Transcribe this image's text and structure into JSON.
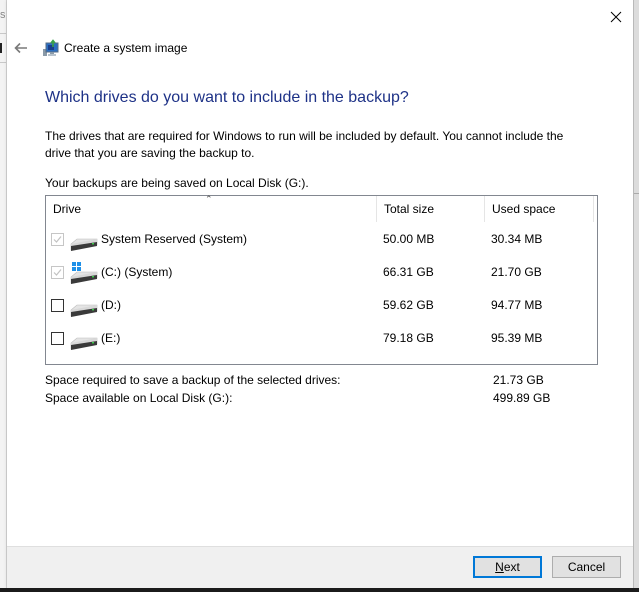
{
  "background_window": {
    "partial_char": "s"
  },
  "window": {
    "title": "Create a system image",
    "app_icon": "system-image-icon",
    "back_icon": "back-arrow-icon",
    "close_icon": "close-icon"
  },
  "page": {
    "heading": "Which drives do you want to include in the backup?",
    "description": "The drives that are required for Windows to run will be included by default. You cannot include the drive that you are saving the backup to.",
    "save_location_note": "Your backups are being saved on Local Disk (G:)."
  },
  "drive_list": {
    "columns": [
      {
        "label": "Drive",
        "sorted": "ascending"
      },
      {
        "label": "Total size"
      },
      {
        "label": "Used space"
      }
    ],
    "sort_icon": "sort-up-icon",
    "rows": [
      {
        "name": "System Reserved (System)",
        "total_size": "50.00 MB",
        "used_space": "30.34 MB",
        "checked": true,
        "disabled": true,
        "icon": "hard-drive-icon"
      },
      {
        "name": "(C:) (System)",
        "total_size": "66.31 GB",
        "used_space": "21.70 GB",
        "checked": true,
        "disabled": true,
        "icon": "windows-drive-icon"
      },
      {
        "name": "(D:)",
        "total_size": "59.62 GB",
        "used_space": "94.77 MB",
        "checked": false,
        "disabled": false,
        "icon": "hard-drive-icon"
      },
      {
        "name": "(E:)",
        "total_size": "79.18 GB",
        "used_space": "95.39 MB",
        "checked": false,
        "disabled": false,
        "icon": "hard-drive-icon"
      }
    ]
  },
  "summary": {
    "space_required_label": "Space required to save a backup of the selected drives:",
    "space_required_value": "21.73 GB",
    "space_available_label": "Space available on Local Disk (G:):",
    "space_available_value": "499.89 GB"
  },
  "buttons": {
    "next": {
      "label_mnemonic": "N",
      "label_rest": "ext"
    },
    "cancel": {
      "label": "Cancel"
    }
  },
  "colors": {
    "heading": "#1e3287",
    "primary_button_border": "#0078d7",
    "footer_bg": "#f0f0f0"
  }
}
